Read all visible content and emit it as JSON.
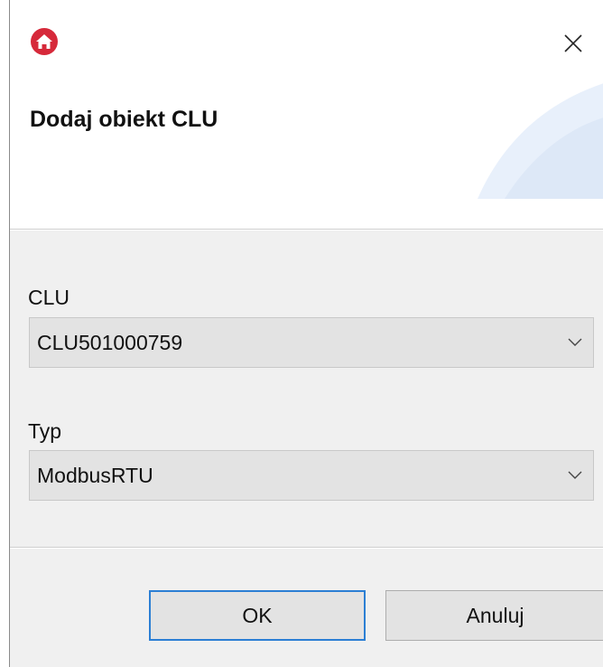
{
  "dialog": {
    "title": "Dodaj obiekt CLU",
    "app_icon": "home-icon",
    "close_icon": "close-icon"
  },
  "fields": {
    "clu": {
      "label": "CLU",
      "value": "CLU501000759"
    },
    "typ": {
      "label": "Typ",
      "value": "ModbusRTU"
    }
  },
  "buttons": {
    "ok_label": "OK",
    "cancel_label": "Anuluj"
  },
  "colors": {
    "accent": "#2c7fd4",
    "app_icon_red": "#d6293a",
    "swoosh": "#e6effa"
  }
}
